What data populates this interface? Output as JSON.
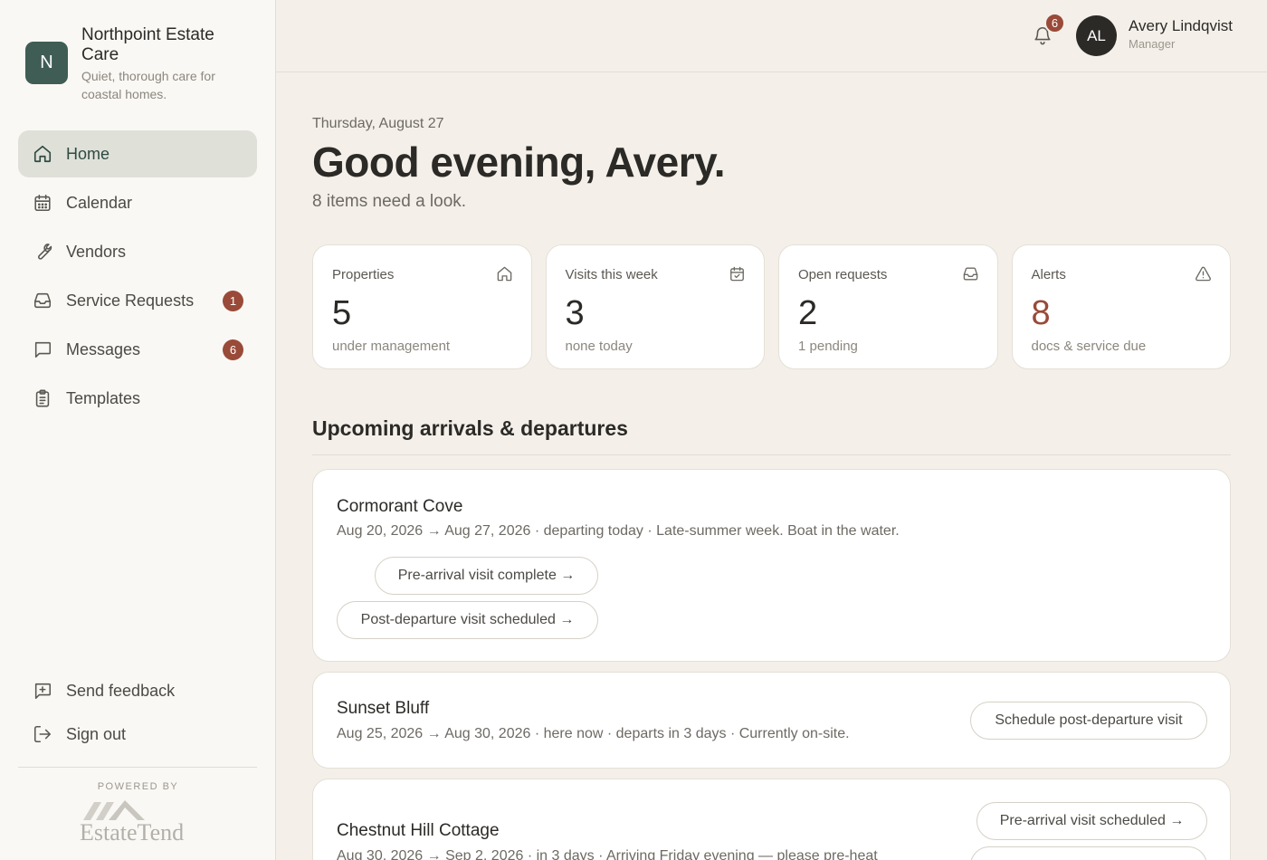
{
  "brand": {
    "initial": "N",
    "name": "Northpoint Estate Care",
    "tagline": "Quiet, thorough care for coastal homes."
  },
  "nav": {
    "items": [
      {
        "label": "Home",
        "icon": "home-icon",
        "active": true
      },
      {
        "label": "Calendar",
        "icon": "calendar-icon"
      },
      {
        "label": "Vendors",
        "icon": "wrench-icon"
      },
      {
        "label": "Service Requests",
        "icon": "inbox-icon",
        "badge": "1"
      },
      {
        "label": "Messages",
        "icon": "message-icon",
        "badge": "6"
      },
      {
        "label": "Templates",
        "icon": "clipboard-icon"
      }
    ],
    "bottom": [
      {
        "label": "Send feedback",
        "icon": "feedback-icon"
      },
      {
        "label": "Sign out",
        "icon": "sign-out-icon"
      }
    ]
  },
  "footer": {
    "powered_by": "POWERED BY",
    "vendor_logo": "EstateTend"
  },
  "topbar": {
    "notification_count": "6",
    "user_initials": "AL",
    "user_name": "Avery Lindqvist",
    "user_role": "Manager"
  },
  "main": {
    "date": "Thursday, August 27",
    "greeting": "Good evening, Avery.",
    "subline": "8 items need a look.",
    "section_title": "Upcoming arrivals & departures"
  },
  "stats": [
    {
      "label": "Properties",
      "value": "5",
      "sub": "under management",
      "icon": "home-icon"
    },
    {
      "label": "Visits this week",
      "value": "3",
      "sub": "none today",
      "icon": "calendar-check-icon"
    },
    {
      "label": "Open requests",
      "value": "2",
      "sub": "1 pending",
      "icon": "inbox-icon"
    },
    {
      "label": "Alerts",
      "value": "8",
      "sub": "docs & service due",
      "icon": "warning-icon"
    }
  ],
  "arrivals": [
    {
      "name": "Cormorant Cove",
      "detail": "Aug 20, 2026 → Aug 27, 2026 · departing today · Late-summer week. Boat in the water.",
      "actions": [
        "Pre-arrival visit complete →",
        "Post-departure visit scheduled →"
      ]
    },
    {
      "name": "Sunset Bluff",
      "detail": "Aug 25, 2026 → Aug 30, 2026 · here now · departs in 3 days · Currently on-site.",
      "actions": [
        "Schedule post-departure visit"
      ]
    },
    {
      "name": "Chestnut Hill Cottage",
      "detail": "Aug 30, 2026 → Sep 2, 2026 · in 3 days · Arriving Friday evening — please pre-heat",
      "actions": [
        "Pre-arrival visit scheduled →"
      ]
    }
  ],
  "colors": {
    "accent": "#3f5d55",
    "badge": "#9a4a38",
    "background": "#f4f0e9",
    "sidebar": "#faf8f4"
  }
}
